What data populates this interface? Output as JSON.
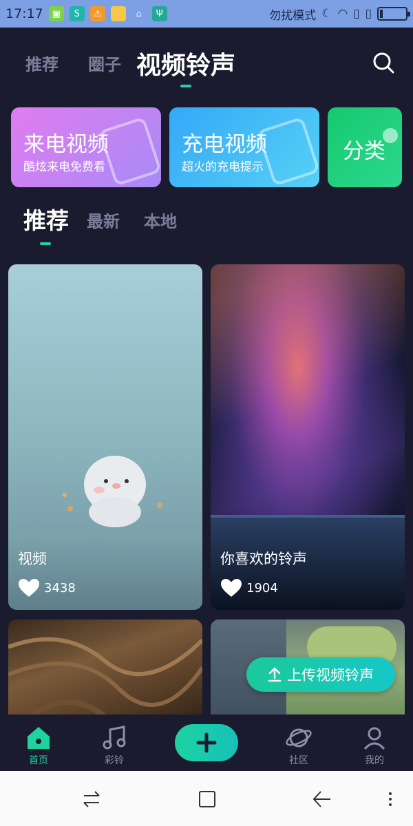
{
  "status_bar": {
    "time": "17:17",
    "dnd_label": "勿扰模式",
    "colors": {
      "background": "#7d9fe3"
    }
  },
  "top_tabs": [
    {
      "label": "推荐",
      "active": false
    },
    {
      "label": "圈子",
      "active": false
    },
    {
      "label": "视频铃声",
      "active": true
    }
  ],
  "feature_cards": [
    {
      "title": "来电视频",
      "subtitle": "酷炫来电免费看",
      "color": "#c67cf0"
    },
    {
      "title": "充电视频",
      "subtitle": "超火的充电提示",
      "color": "#47b6f7"
    },
    {
      "title": "分类",
      "subtitle": "",
      "color": "#1fcf7c"
    }
  ],
  "sub_tabs": [
    {
      "label": "推荐",
      "active": true
    },
    {
      "label": "最新",
      "active": false
    },
    {
      "label": "本地",
      "active": false
    }
  ],
  "videos": [
    {
      "title": "视频",
      "likes": "3438"
    },
    {
      "title": "你喜欢的铃声",
      "likes": "1904"
    },
    {
      "title": "",
      "likes": ""
    },
    {
      "title": "",
      "likes": ""
    }
  ],
  "upload_button": {
    "label": "上传视频铃声"
  },
  "bottom_nav": [
    {
      "label": "首页",
      "icon": "home-icon",
      "active": true
    },
    {
      "label": "彩铃",
      "icon": "music-note-icon",
      "active": false
    },
    {
      "label": "",
      "icon": "plus-icon",
      "active": false
    },
    {
      "label": "社区",
      "icon": "planet-icon",
      "active": false
    },
    {
      "label": "我的",
      "icon": "user-icon",
      "active": false
    }
  ],
  "accent_color": "#1ed3a0"
}
